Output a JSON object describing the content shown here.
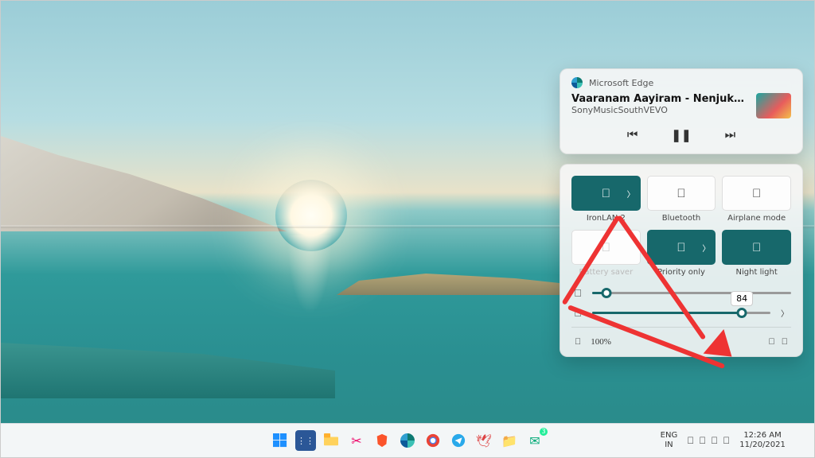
{
  "media": {
    "app": "Microsoft Edge",
    "title": "Vaaranam Aayiram - Nenjukkul Peid…",
    "artist": "SonyMusicSouthVEVO",
    "prev_icon": "⏮",
    "play_icon": "❚❚",
    "next_icon": "⏭"
  },
  "quick_settings": {
    "tiles": [
      {
        "name": "wifi",
        "label": "IronLAN 2",
        "on": true,
        "icon": "",
        "has_sub": true
      },
      {
        "name": "bluetooth",
        "label": "Bluetooth",
        "on": false,
        "icon": "",
        "has_sub": false
      },
      {
        "name": "airplane",
        "label": "Airplane mode",
        "on": false,
        "icon": "",
        "has_sub": false
      },
      {
        "name": "battery-saver",
        "label": "Battery saver",
        "on": false,
        "icon": "",
        "has_sub": false,
        "disabled": true
      },
      {
        "name": "focus",
        "label": "Priority only",
        "on": true,
        "icon": "",
        "has_sub": true
      },
      {
        "name": "night-light",
        "label": "Night light",
        "on": true,
        "icon": "",
        "has_sub": false
      }
    ],
    "brightness": {
      "value": 7,
      "icon": ""
    },
    "volume": {
      "value": 84,
      "icon": "",
      "tooltip": "84"
    },
    "battery_text": "100%",
    "battery_icon": "",
    "edit_icon": "",
    "settings_icon": ""
  },
  "taskbar": {
    "lang1": "ENG",
    "lang2": "IN",
    "time": "12:26 AM",
    "date": "11/20/2021",
    "tray_icons": [
      "",
      "",
      "",
      ""
    ],
    "chevron": "",
    "notif_icon": ""
  },
  "colors": {
    "accent": "#17686b",
    "annotation": "#e33"
  }
}
